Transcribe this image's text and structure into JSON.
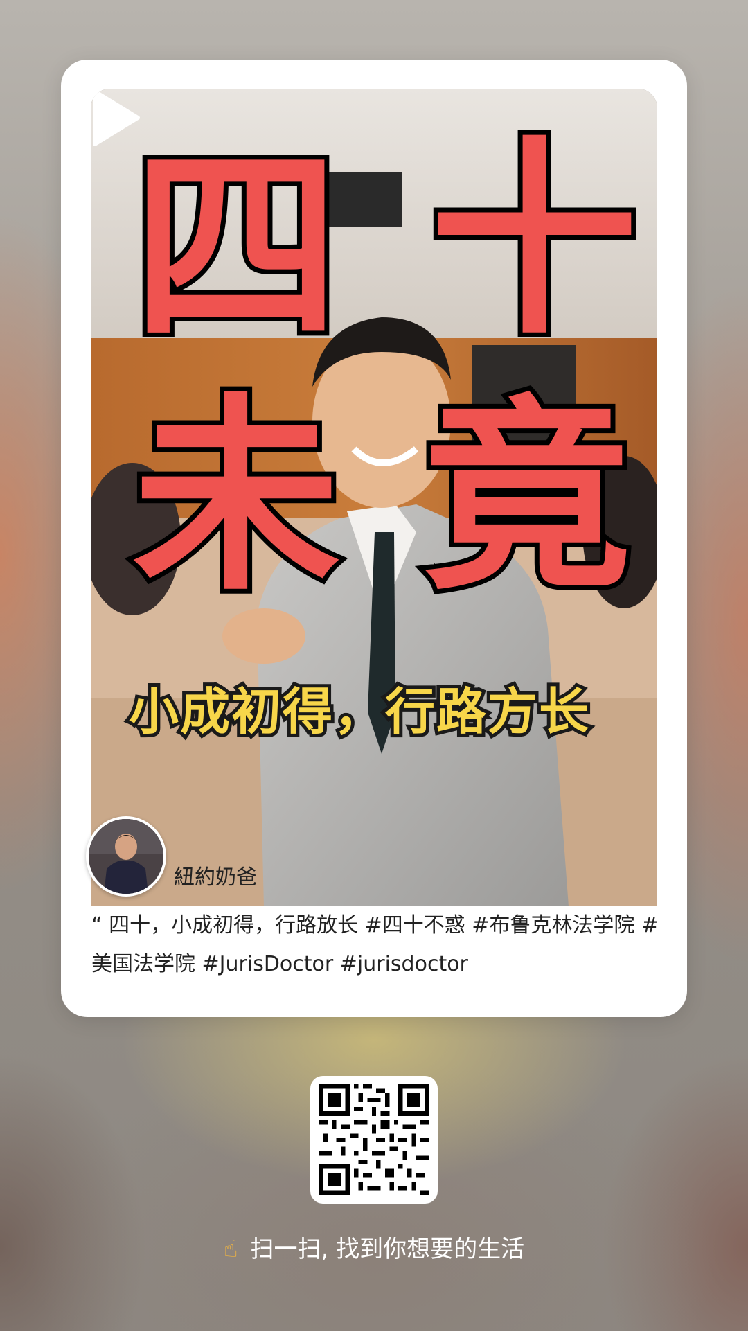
{
  "cover": {
    "big_chars": [
      "四",
      "十",
      "未",
      "竟"
    ],
    "subtitle": "小成初得，行路方长"
  },
  "author": {
    "name": "紐約奶爸"
  },
  "description": "“ 四十，小成初得，行路放长 #四十不惑  #布鲁克林法学院  #美国法学院  #JurisDoctor  #jurisdoctor",
  "footer": {
    "hint": "扫一扫, 找到你想要的生活",
    "hand_icon": "pointing-hand-icon"
  },
  "colors": {
    "accent_red": "#ef5350",
    "subtitle_yellow": "#f7d64a",
    "card_bg": "#ffffff"
  }
}
